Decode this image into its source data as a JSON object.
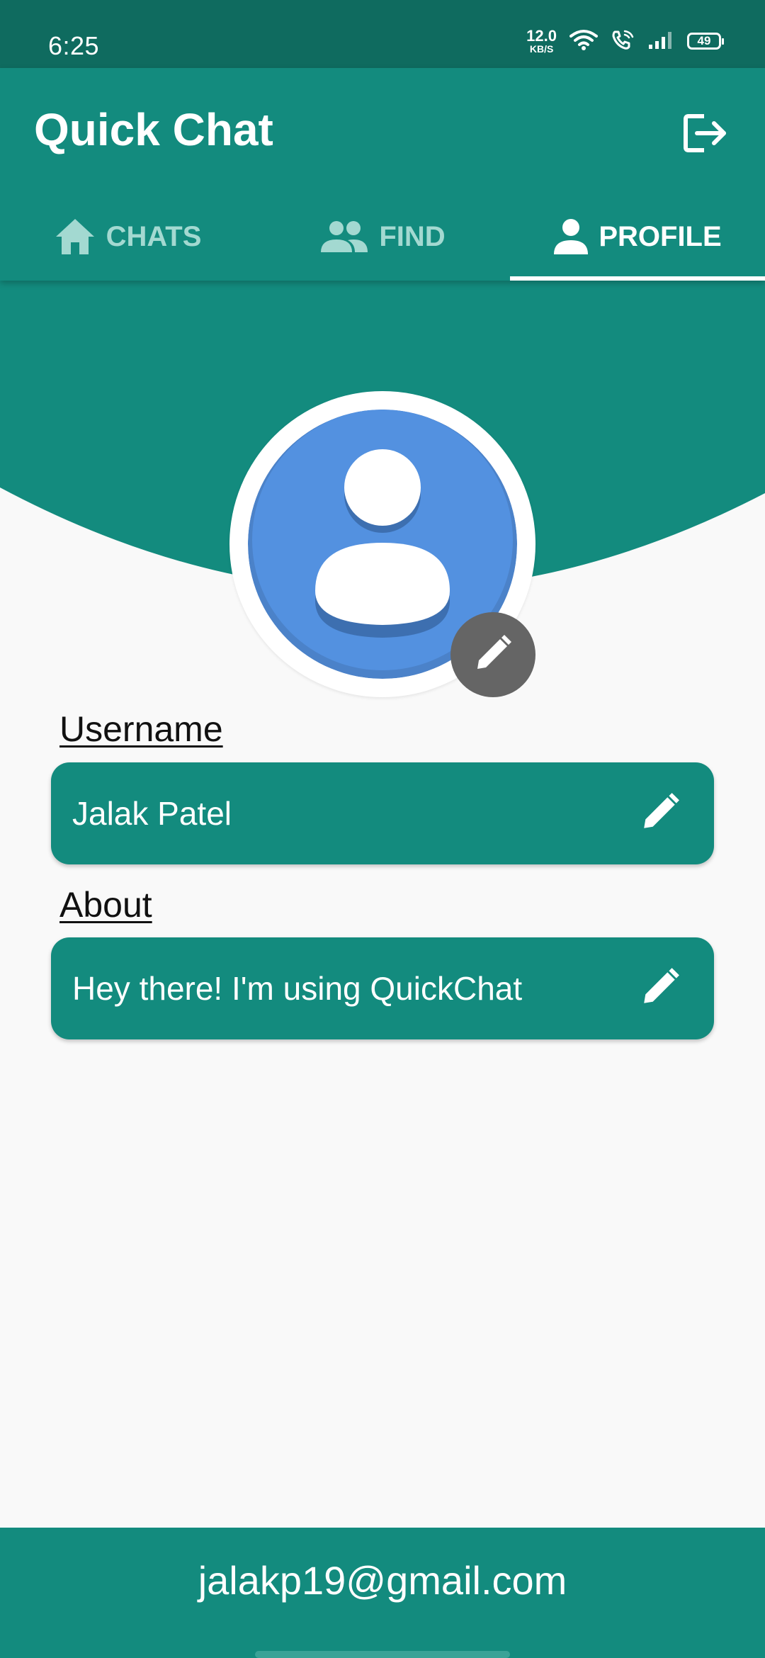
{
  "status_bar": {
    "time": "6:25",
    "net_speed_value": "12.0",
    "net_speed_unit": "KB/S",
    "battery_level": "49"
  },
  "app_bar": {
    "title": "Quick Chat",
    "tabs": [
      {
        "label": "CHATS",
        "icon": "home-icon",
        "active": false
      },
      {
        "label": "FIND",
        "icon": "people-icon",
        "active": false
      },
      {
        "label": "PROFILE",
        "icon": "person-icon",
        "active": true
      }
    ]
  },
  "profile": {
    "username_label": "Username",
    "username_value": "Jalak Patel",
    "about_label": "About",
    "about_value": "Hey there! I'm using QuickChat",
    "email": "jalakp19@gmail.com"
  },
  "colors": {
    "primary": "#138b7e",
    "primary_dark": "#0f6b5f",
    "avatar_blue": "#5391e0",
    "tab_inactive": "#a3d9d1",
    "edit_fab": "#656565"
  }
}
